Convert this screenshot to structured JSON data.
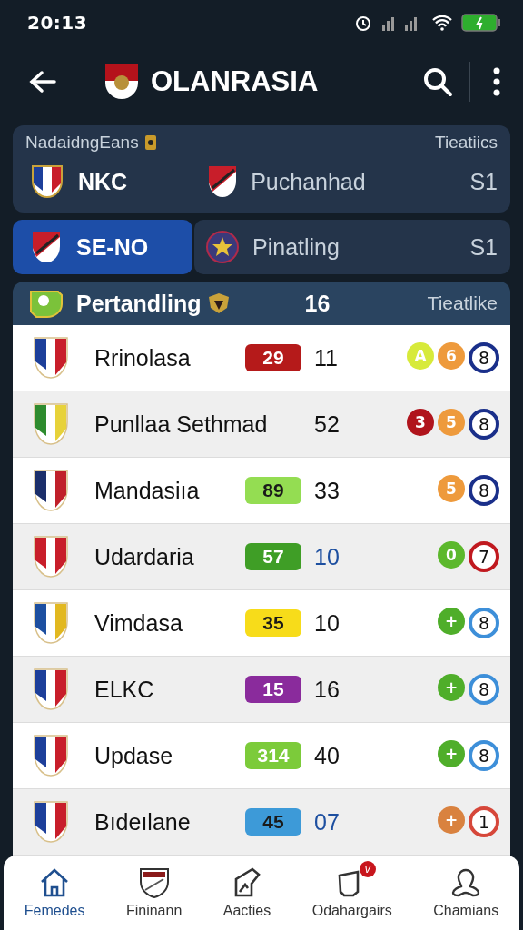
{
  "status_bar": {
    "time": "20:13"
  },
  "header": {
    "title": "OLANRASIA"
  },
  "summary": {
    "title": "NadaidngEans",
    "right_label": "Tieatiics",
    "home": "NKC",
    "away": "Puchanhad",
    "score": "S1"
  },
  "tabs": [
    {
      "label": "SE-NO",
      "selected": true
    },
    {
      "label": "Pinatling",
      "score": "S1",
      "selected": false
    }
  ],
  "table": {
    "title": "Pertandling",
    "count": "16",
    "right_label": "Tieatlike",
    "rows": [
      {
        "name": "Rrinolasa",
        "badge": {
          "text": "29",
          "color": "#b51a1a",
          "dark_text": false
        },
        "number": "11",
        "highlight": false,
        "marks": [
          {
            "text": "A",
            "color": "#d7ea3a",
            "kind": "dot"
          },
          {
            "text": "6",
            "color": "#ee9a3c",
            "kind": "dot"
          },
          {
            "text": "8",
            "color": "#1a2f8a",
            "kind": "ring"
          }
        ]
      },
      {
        "name": "Punllaa Sethmad",
        "number": "52",
        "highlight": false,
        "marks": [
          {
            "text": "3",
            "color": "#b0141c",
            "kind": "dot"
          },
          {
            "text": "5",
            "color": "#ee9a3c",
            "kind": "dot"
          },
          {
            "text": "8",
            "color": "#1a2f8a",
            "kind": "ring"
          }
        ]
      },
      {
        "name": "Mandasiıa",
        "badge": {
          "text": "89",
          "color": "#94dd52",
          "dark_text": true
        },
        "number": "33",
        "highlight": false,
        "marks": [
          {
            "text": "5",
            "color": "#ee9a3c",
            "kind": "dot"
          },
          {
            "text": "8",
            "color": "#1a2f8a",
            "kind": "ring"
          }
        ]
      },
      {
        "name": "Udardaria",
        "badge": {
          "text": "57",
          "color": "#3f9e26",
          "dark_text": false
        },
        "number": "10",
        "highlight": true,
        "marks": [
          {
            "text": "0",
            "color": "#5cb82c",
            "kind": "dot"
          },
          {
            "text": "7",
            "color": "#c0191f",
            "kind": "ring"
          }
        ]
      },
      {
        "name": "Vimdasa",
        "badge": {
          "text": "35",
          "color": "#f7dc1a",
          "dark_text": true
        },
        "number": "10",
        "highlight": false,
        "marks": [
          {
            "text": "+",
            "color": "#4fae2a",
            "kind": "dot"
          },
          {
            "text": "8",
            "color": "#3d8fd9",
            "kind": "ring"
          }
        ]
      },
      {
        "name": "ELKC",
        "badge": {
          "text": "15",
          "color": "#8a2b9c",
          "dark_text": false
        },
        "number": "16",
        "highlight": false,
        "marks": [
          {
            "text": "+",
            "color": "#4fae2a",
            "kind": "dot"
          },
          {
            "text": "8",
            "color": "#3d8fd9",
            "kind": "ring"
          }
        ]
      },
      {
        "name": "Updase",
        "badge": {
          "text": "314",
          "color": "#7ccb3a",
          "dark_text": false
        },
        "number": "40",
        "highlight": false,
        "marks": [
          {
            "text": "+",
            "color": "#4fae2a",
            "kind": "dot"
          },
          {
            "text": "8",
            "color": "#3d8fd9",
            "kind": "ring"
          }
        ]
      },
      {
        "name": "Bıdeılane",
        "badge": {
          "text": "45",
          "color": "#3d9ad8",
          "dark_text": true
        },
        "number": "07",
        "highlight": true,
        "marks": [
          {
            "text": "+",
            "color": "#d9823f",
            "kind": "dot"
          },
          {
            "text": "1",
            "color": "#d6473a",
            "kind": "ring"
          }
        ]
      }
    ]
  },
  "bottom_nav": [
    {
      "label": "Femedes",
      "selected": true
    },
    {
      "label": "Fininann",
      "selected": false
    },
    {
      "label": "Aacties",
      "selected": false
    },
    {
      "label": "Odahargairs",
      "selected": false,
      "badge": "v"
    },
    {
      "label": "Chamians",
      "selected": false
    }
  ]
}
